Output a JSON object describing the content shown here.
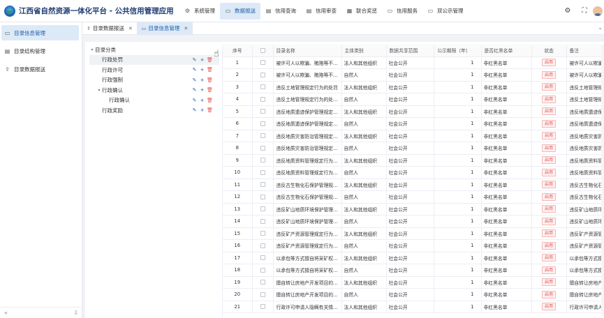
{
  "app": {
    "title": "江西省自然资源一体化平台 - 公共信用管理应用"
  },
  "nav": [
    {
      "label": "系统管理",
      "icon": "gear-icon",
      "glyph": "⚙",
      "active": false
    },
    {
      "label": "数据报送",
      "icon": "folder-icon",
      "glyph": "▭",
      "active": true
    },
    {
      "label": "信用查询",
      "icon": "document-icon",
      "glyph": "▤",
      "active": false
    },
    {
      "label": "信用审查",
      "icon": "document-icon",
      "glyph": "▤",
      "active": false
    },
    {
      "label": "联合奖惩",
      "icon": "grid-icon",
      "glyph": "▦",
      "active": false
    },
    {
      "label": "信用服务",
      "icon": "folder-icon",
      "glyph": "▭",
      "active": false
    },
    {
      "label": "双公示管理",
      "icon": "folder-icon",
      "glyph": "▭",
      "active": false
    }
  ],
  "sidebar": {
    "items": [
      {
        "label": "目录信息管理",
        "glyph": "▭",
        "active": true
      },
      {
        "label": "目录结构管理",
        "glyph": "▤",
        "active": false
      },
      {
        "label": "目录数据报送",
        "glyph": "⇪",
        "active": false
      }
    ],
    "collapse_glyph": "«",
    "pin_glyph": "⇩"
  },
  "tabs": [
    {
      "label": "目录数据报送",
      "glyph": "⇪",
      "close": "✕",
      "active": false
    },
    {
      "label": "目录信息管理",
      "glyph": "▭",
      "close": "✕",
      "active": true
    }
  ],
  "tabs_more": "⌄",
  "tree": {
    "root": {
      "label": "目录分类",
      "arrow": "▾"
    },
    "nodes": [
      {
        "label": "行政处罚",
        "level": 1,
        "arrow": "",
        "selected": true
      },
      {
        "label": "行政许可",
        "level": 1,
        "arrow": "",
        "selected": false
      },
      {
        "label": "行政强制",
        "level": 1,
        "arrow": "",
        "selected": false
      },
      {
        "label": "行政确认",
        "level": 1,
        "arrow": "▾",
        "selected": false
      },
      {
        "label": "行政确认",
        "level": 2,
        "arrow": "",
        "selected": false
      },
      {
        "label": "行政奖励",
        "level": 1,
        "arrow": "",
        "selected": false
      }
    ],
    "actions": {
      "edit": "✎",
      "add": "+",
      "delete": "🗑"
    },
    "cursor_glyph": "☝"
  },
  "table": {
    "columns": [
      "序号",
      "",
      "目录名称",
      "主体类别",
      "数据共享范围",
      "公示期限（年）",
      "是否红黑名单",
      "状态",
      "备注"
    ],
    "rows": [
      {
        "idx": "1",
        "name": "被许可人以欺骗、贿赂等不...",
        "subject": "法人和其他组织",
        "scope": "社会公开",
        "period": "1",
        "red": "非红黑名单",
        "status": "启用",
        "note": "被许可人以欺骗"
      },
      {
        "idx": "2",
        "name": "被许可人以欺骗、贿赂等不...",
        "subject": "自然人",
        "scope": "社会公开",
        "period": "1",
        "red": "非红黑名单",
        "status": "启用",
        "note": "被许可人以欺骗"
      },
      {
        "idx": "3",
        "name": "违反土地管理规定行为的处罚",
        "subject": "法人和其他组织",
        "scope": "社会公开",
        "period": "1",
        "red": "非红黑名单",
        "status": "启用",
        "note": "违反土地管理规"
      },
      {
        "idx": "4",
        "name": "违反土地管理规定行为的处...",
        "subject": "自然人",
        "scope": "社会公开",
        "period": "1",
        "red": "非红黑名单",
        "status": "启用",
        "note": "违反土地管理规"
      },
      {
        "idx": "5",
        "name": "违反地质遗迹保护管理规定...",
        "subject": "法人和其他组织",
        "scope": "社会公开",
        "period": "1",
        "red": "非红黑名单",
        "status": "启用",
        "note": "违反地质遗迹保"
      },
      {
        "idx": "6",
        "name": "违反地质遗迹保护管理规定...",
        "subject": "自然人",
        "scope": "社会公开",
        "period": "1",
        "red": "非红黑名单",
        "status": "启用",
        "note": "违反地质遗迹保"
      },
      {
        "idx": "7",
        "name": "违反地质灾害防治管理规定...",
        "subject": "法人和其他组织",
        "scope": "社会公开",
        "period": "1",
        "red": "非红黑名单",
        "status": "启用",
        "note": "违反地质灾害防"
      },
      {
        "idx": "8",
        "name": "违反地质灾害防治管理规定...",
        "subject": "自然人",
        "scope": "社会公开",
        "period": "1",
        "red": "非红黑名单",
        "status": "启用",
        "note": "违反地质灾害防"
      },
      {
        "idx": "9",
        "name": "违反地质资料管理规定行为...",
        "subject": "法人和其他组织",
        "scope": "社会公开",
        "period": "1",
        "red": "非红黑名单",
        "status": "启用",
        "note": "违反地质资料管"
      },
      {
        "idx": "10",
        "name": "违反地质资料管理规定行为...",
        "subject": "自然人",
        "scope": "社会公开",
        "period": "1",
        "red": "非红黑名单",
        "status": "启用",
        "note": "违反地质资料管"
      },
      {
        "idx": "11",
        "name": "违反古生物化石保护管理规...",
        "subject": "法人和其他组织",
        "scope": "社会公开",
        "period": "1",
        "red": "非红黑名单",
        "status": "启用",
        "note": "违反古生物化石"
      },
      {
        "idx": "12",
        "name": "违反古生物化石保护管理规...",
        "subject": "自然人",
        "scope": "社会公开",
        "period": "1",
        "red": "非红黑名单",
        "status": "启用",
        "note": "违反古生物化石"
      },
      {
        "idx": "13",
        "name": "违反矿山地质环境保护管理...",
        "subject": "法人和其他组织",
        "scope": "社会公开",
        "period": "1",
        "red": "非红黑名单",
        "status": "启用",
        "note": "违反矿山地质环"
      },
      {
        "idx": "14",
        "name": "违反矿山地质环境保护管理...",
        "subject": "自然人",
        "scope": "社会公开",
        "period": "1",
        "red": "非红黑名单",
        "status": "启用",
        "note": "违反矿山地质环"
      },
      {
        "idx": "15",
        "name": "违反矿产资源管理规定行为...",
        "subject": "法人和其他组织",
        "scope": "社会公开",
        "period": "1",
        "red": "非红黑名单",
        "status": "启用",
        "note": "违反矿产资源管"
      },
      {
        "idx": "16",
        "name": "违反矿产资源管理规定行为...",
        "subject": "自然人",
        "scope": "社会公开",
        "period": "1",
        "red": "非红黑名单",
        "status": "启用",
        "note": "违反矿产资源管"
      },
      {
        "idx": "17",
        "name": "以承包等方式擅自将采矿权...",
        "subject": "法人和其他组织",
        "scope": "社会公开",
        "period": "1",
        "red": "非红黑名单",
        "status": "启用",
        "note": "以承包等方式擅"
      },
      {
        "idx": "18",
        "name": "以承包等方式擅自将采矿权...",
        "subject": "自然人",
        "scope": "社会公开",
        "period": "1",
        "red": "非红黑名单",
        "status": "启用",
        "note": "以承包等方式擅"
      },
      {
        "idx": "19",
        "name": "擅自转让房地产开发项目的...",
        "subject": "法人和其他组织",
        "scope": "社会公开",
        "period": "1",
        "red": "非红黑名单",
        "status": "启用",
        "note": "擅自转让房地产"
      },
      {
        "idx": "20",
        "name": "擅自转让房地产开发项目的...",
        "subject": "自然人",
        "scope": "社会公开",
        "period": "1",
        "red": "非红黑名单",
        "status": "启用",
        "note": "擅自转让房地产"
      },
      {
        "idx": "21",
        "name": "行政许可申请人隐瞒有关情...",
        "subject": "法人和其他组织",
        "scope": "社会公开",
        "period": "1",
        "red": "非红黑名单",
        "status": "启用",
        "note": "行政许可申请人"
      }
    ]
  },
  "header_right": [
    {
      "name": "settings-icon",
      "glyph": "⚙"
    },
    {
      "name": "fullscreen-icon",
      "glyph": "⛶"
    }
  ],
  "colors": {
    "accent": "#1f5fa8",
    "active_bg": "#dce9f7",
    "danger": "#e55353"
  }
}
